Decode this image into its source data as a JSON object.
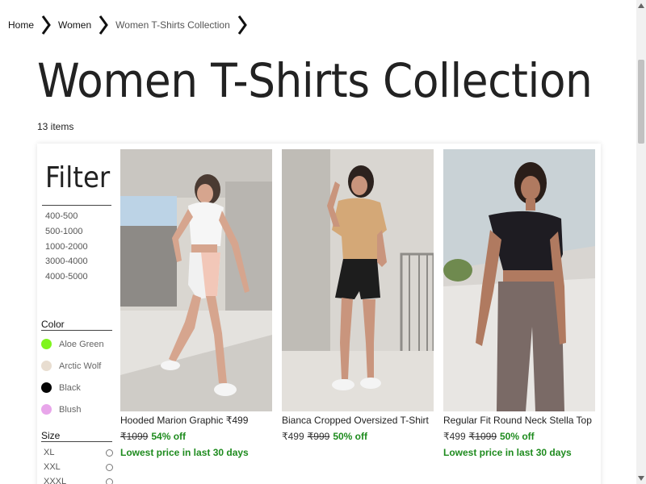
{
  "breadcrumb": {
    "items": [
      "Home",
      "Women",
      "Women T-Shirts Collection"
    ]
  },
  "page": {
    "title": "Women T-Shirts Collection",
    "item_count": "13 items"
  },
  "filter": {
    "title": "Filter",
    "price_ranges": [
      "400-500",
      "500-1000",
      "1000-2000",
      "3000-4000",
      "4000-5000"
    ],
    "color_label": "Color",
    "colors": [
      {
        "name": "Aloe Green",
        "hex": "#7ff51d"
      },
      {
        "name": "Arctic Wolf",
        "hex": "#e8ddd0"
      },
      {
        "name": "Black",
        "hex": "#050505"
      },
      {
        "name": "Blush",
        "hex": "#e8a6ea"
      }
    ],
    "size_label": "Size",
    "sizes": [
      "XL",
      "XXL",
      "XXXL"
    ]
  },
  "products": [
    {
      "name": "Hooded Marion Graphic ₹499",
      "mrp": "₹1099",
      "sale": "",
      "discount": "54% off",
      "lowest": "Lowest price in last 30 days"
    },
    {
      "name": "Bianca Cropped Oversized T-Shirt",
      "mrp": "₹999",
      "sale": "₹499",
      "discount": "50% off",
      "lowest": ""
    },
    {
      "name": "Regular Fit Round Neck Stella Top",
      "mrp": "₹1099",
      "sale": "₹499",
      "discount": "50% off",
      "lowest": "Lowest price in last 30 days"
    }
  ],
  "colors": {
    "discount_green": "#1e8b1e",
    "text": "#222222"
  }
}
